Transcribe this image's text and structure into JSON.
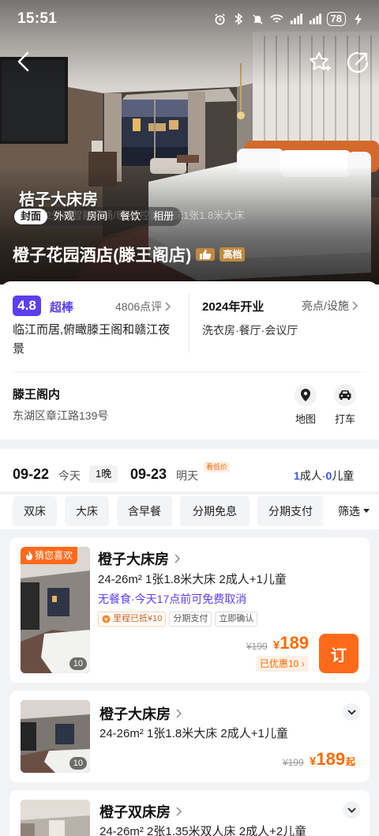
{
  "status": {
    "time": "15:51",
    "battery": "78"
  },
  "hero": {
    "photo_caption": "桔子大床房",
    "photo_subcaption": "2外观智能马桶/暖/遥控窗帘/床1张1.8米大床",
    "photo_tabs": [
      "封面",
      "外观",
      "房间",
      "餐饮",
      "相册"
    ],
    "hotel_name": "橙子花园酒店(滕王阁店)",
    "grade_badge": "高档"
  },
  "info": {
    "rating": "4.8",
    "rating_word": "超棒",
    "reviews": "4806点评",
    "highlight": "临江而居,俯瞰滕王阁和赣江夜景",
    "open_year": "2024年开业",
    "facility_link": "亮点/设施",
    "facilities": "洗衣房·餐厅·会议厅",
    "area": "滕王阁内",
    "address": "东湖区章江路139号",
    "map_label": "地图",
    "taxi_label": "打车"
  },
  "dates": {
    "checkin": "09-22",
    "checkin_day": "今天",
    "nights": "1晚",
    "checkout": "09-23",
    "checkout_day": "明天",
    "low_price_tag": "看低价",
    "adults_count": "1",
    "adults_label": "成人",
    "sep": "·",
    "children_count": "0",
    "children_label": "儿童"
  },
  "filters": {
    "chips": [
      "双床",
      "大床",
      "含早餐",
      "分期免息",
      "分期支付"
    ],
    "filter_button": "筛选"
  },
  "rooms": [
    {
      "name": "橙子大床房",
      "guess_tag": "猜您喜欢",
      "spec": "24-26m² 1张1.8米大床 2成人+1儿童",
      "policy": "无餐食·今天17点前可免费取消",
      "tags": [
        "里程已抵¥10",
        "分期支付",
        "立即确认"
      ],
      "photo_count": "10",
      "old_price": "¥199",
      "currency": "¥",
      "price": "189",
      "discount": "已优惠10",
      "book_label": "订"
    },
    {
      "name": "橙子大床房",
      "spec": "24-26m² 1张1.8米大床 2成人+1儿童",
      "photo_count": "10",
      "old_price": "¥199",
      "currency": "¥",
      "price": "189",
      "price_suffix": "起"
    },
    {
      "name": "橙子双床房",
      "spec": "24-26m² 2张1.35米双人床 2成人+2儿童"
    }
  ],
  "colors": {
    "accent_purple": "#5b3ff0",
    "price_orange": "#ff6a00",
    "book_orange": "#ff6a1a",
    "guest_blue": "#3a55ff"
  }
}
